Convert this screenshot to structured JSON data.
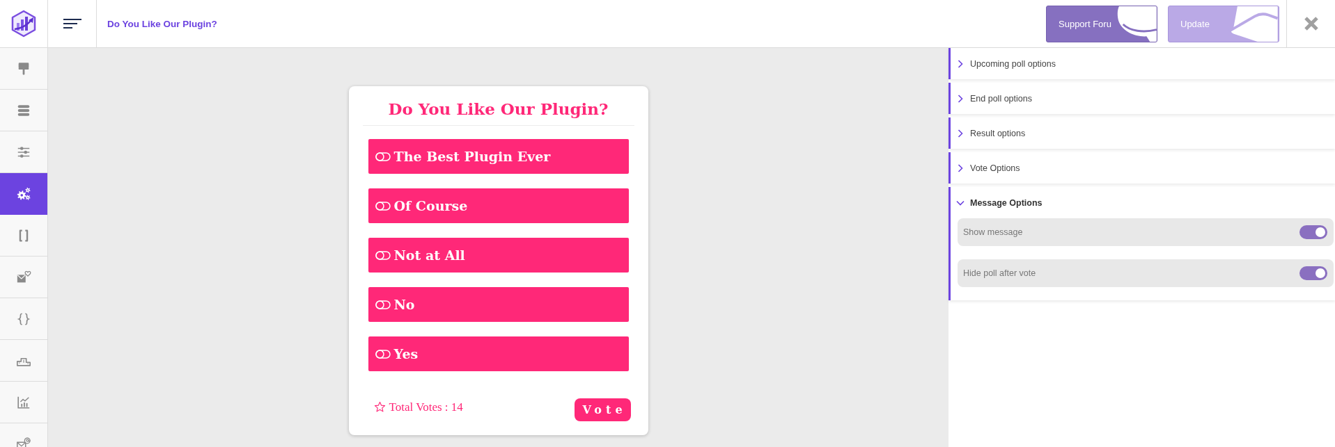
{
  "header": {
    "title": "Do You Like Our Plugin?",
    "buttons": [
      {
        "kind": "support",
        "label": "Support Foru"
      },
      {
        "kind": "update",
        "label": "Update"
      }
    ]
  },
  "sidebar": {
    "items": [
      {
        "selected": false
      },
      {
        "selected": false
      },
      {
        "selected": false
      },
      {
        "selected": true
      },
      {
        "selected": false
      },
      {
        "selected": false
      },
      {
        "selected": false
      },
      {
        "selected": false
      },
      {
        "selected": false
      },
      {
        "selected": false
      }
    ]
  },
  "poll": {
    "title": "Do You Like Our Plugin?",
    "options": [
      "The Best Plugin Ever",
      "Of Course",
      "Not at All",
      "No",
      "Yes"
    ],
    "total_votes": "Total Votes : 14",
    "vote_button": "Vote"
  },
  "settings": {
    "sections": [
      {
        "title": "Upcoming poll options",
        "expanded": false
      },
      {
        "title": "End poll options",
        "expanded": false
      },
      {
        "title": "Result options",
        "expanded": false
      },
      {
        "title": "Vote Options",
        "expanded": false
      },
      {
        "title": "Message Options",
        "expanded": true,
        "toggles": [
          {
            "label": "Show message",
            "on": true
          },
          {
            "label": "Hide poll after vote",
            "on": true
          }
        ]
      }
    ]
  }
}
